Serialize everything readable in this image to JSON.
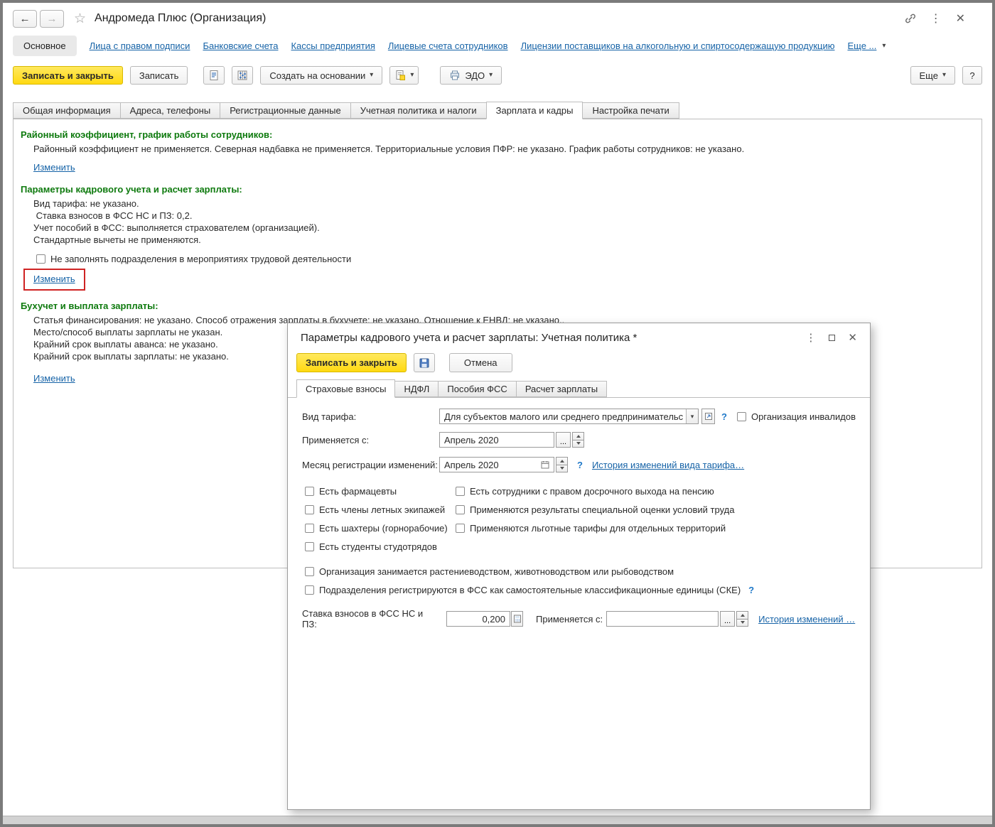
{
  "icons": {
    "caret_down": "▾",
    "back": "←",
    "forward": "→",
    "star": "☆",
    "kebab": "⋮",
    "close": "✕",
    "dots_button": "...",
    "question": "?"
  },
  "titlebar": {
    "title": "Андромеда Плюс (Организация)"
  },
  "nav": {
    "active": "Основное",
    "links": [
      "Лица с правом подписи",
      "Банковские счета",
      "Кассы предприятия",
      "Лицевые счета сотрудников",
      "Лицензии поставщиков на алкогольную и спиртосодержащую продукцию"
    ],
    "more": "Еще ..."
  },
  "toolbar": {
    "save_close": "Записать и закрыть",
    "save": "Записать",
    "create_based_on": "Создать на основании",
    "edo": "ЭДО",
    "more": "Еще"
  },
  "tabs": [
    "Общая информация",
    "Адреса, телефоны",
    "Регистрационные данные",
    "Учетная политика и налоги",
    "Зарплата и кадры",
    "Настройка печати"
  ],
  "content": {
    "district": {
      "heading": "Районный коэффициент, график работы сотрудников:",
      "text": "Районный коэффициент не применяется. Северная надбавка не применяется. Территориальные условия ПФР: не указано. График работы сотрудников: не указано.",
      "change_link": "Изменить"
    },
    "hr_params": {
      "heading": "Параметры кадрового учета и расчет зарплаты:",
      "lines": [
        "Вид тарифа: не указано.",
        " Ставка взносов в ФСС НС и ПЗ: 0,2.",
        "Учет пособий в ФСС: выполняется страхователем (организацией).",
        "Стандартные вычеты не применяются."
      ],
      "checkbox_label": "Не заполнять подразделения в мероприятиях трудовой деятельности",
      "change_link": "Изменить"
    },
    "accounting": {
      "heading": "Бухучет и выплата зарплаты:",
      "lines": [
        "Статья финансирования: не указано. Способ отражения зарплаты в бухучете: не указано. Отношение к ЕНВД: не указано..",
        "Место/способ выплаты зарплаты не указан.",
        "Крайний срок выплаты аванса: не указано.",
        "Крайний срок выплаты зарплаты: не указано."
      ],
      "change_link": "Изменить"
    }
  },
  "dialog": {
    "title": "Параметры кадрового учета и расчет зарплаты: Учетная политика *",
    "toolbar": {
      "save_close": "Записать и закрыть",
      "cancel": "Отмена"
    },
    "tabs": [
      "Страховые взносы",
      "НДФЛ",
      "Пособия ФСС",
      "Расчет зарплаты"
    ],
    "tariff": {
      "label": "Вид тарифа:",
      "value": "Для субъектов малого или среднего предпринимательс",
      "invalid_org_label": "Организация инвалидов"
    },
    "applies_from": {
      "label": "Применяется с:",
      "value": "Апрель 2020"
    },
    "reg_month": {
      "label": "Месяц регистрации изменений:",
      "value": "Апрель 2020",
      "history_link": "История изменений вида тарифа…"
    },
    "checkboxes_left": [
      "Есть фармацевты",
      "Есть члены летных экипажей",
      "Есть шахтеры (горнорабочие)",
      "Есть студенты студотрядов"
    ],
    "checkboxes_right": [
      "Есть сотрудники с правом досрочного выхода на пенсию",
      "Применяются результаты специальной оценки условий труда",
      "Применяются льготные тарифы для отдельных территорий"
    ],
    "checkbox_agro": "Организация занимается растениеводством, животноводством или рыбоводством",
    "checkbox_ske": "Подразделения регистрируются в ФСС как самостоятельные классификационные единицы (СКЕ)",
    "fss_rate": {
      "label": "Ставка взносов в ФСС НС и ПЗ:",
      "value": "0,200",
      "applies_label": "Применяется с:",
      "applies_value": "",
      "history_link": "История изменений …"
    }
  }
}
